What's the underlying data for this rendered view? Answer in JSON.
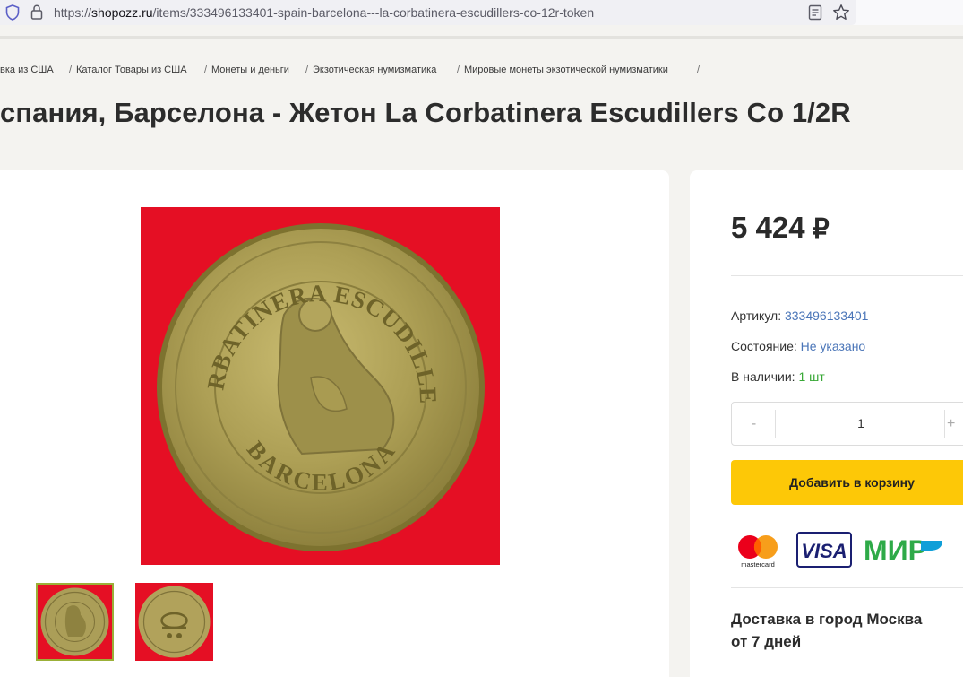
{
  "browser": {
    "url_prefix": "https://",
    "url_host": "shopozz.ru",
    "url_path": "/items/333496133401-spain-barcelona---la-corbatinera-escudillers-co-12r-token"
  },
  "breadcrumb": [
    {
      "label": "вка из США"
    },
    {
      "label": "Каталог Товары из США"
    },
    {
      "label": "Монеты и деньги"
    },
    {
      "label": "Экзотическая нумизматика"
    },
    {
      "label": "Мировые монеты экзотической нумизматики"
    }
  ],
  "breadcrumb_separator": "/",
  "title": "спания, Барселона - Жетон La Corbatinera Escudillers Co 1/2R",
  "coin": {
    "legend_top": "LA CORBATINERA ESCUDILLERS 60",
    "legend_bottom": "BARCELONA"
  },
  "product": {
    "price": "5 424",
    "currency": "₽",
    "sku_label": "Артикул:",
    "sku": "333496133401",
    "condition_label": "Состояние:",
    "condition": "Не указано",
    "stock_label": "В наличии:",
    "stock": "1 шт",
    "qty_minus": "-",
    "qty_value": "1",
    "qty_plus": "+",
    "add_to_cart": "Добавить в корзину",
    "payments": {
      "mastercard": "mastercard",
      "visa": "VISA",
      "mir": "МИР"
    },
    "delivery_line1": "Доставка в город Москва",
    "delivery_line2": "от 7 дней"
  },
  "colors": {
    "accent_button": "#fdc807",
    "link": "#4a75b8",
    "in_stock": "#38a836",
    "image_background": "#e50f24"
  }
}
